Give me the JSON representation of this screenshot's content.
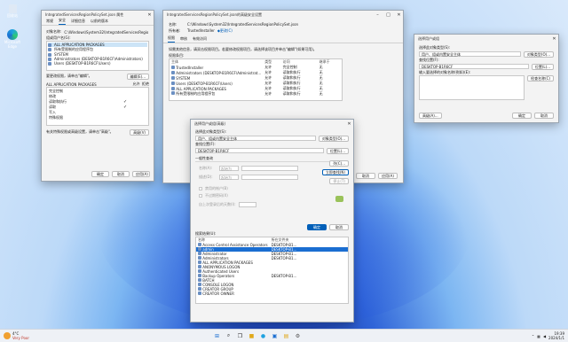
{
  "desktop": {
    "icon1": "回收站",
    "icon2": "Microsoft Edge"
  },
  "w1": {
    "title": "IntegratedServicesRegionPolicySet.json 属性",
    "tabs": [
      "常规",
      "安全",
      "详细信息",
      "以前的版本"
    ],
    "objname_label": "对象名称:",
    "objname": "C:\\Windows\\System32\\IntegratedServicesRegio",
    "group_label": "组或用户名(G):",
    "users": [
      "ALL APPLICATION PACKAGES",
      "所有受限制的应用程序包",
      "SYSTEM",
      "Administrators (DESKTOP-B1R6CF\\Administrators)",
      "Users (DESKTOP-B1R6CF\\Users)"
    ],
    "edit_hint": "要更改权限，请单击\"编辑\"。",
    "edit_btn": "编辑(E)...",
    "perm_for": "ALL APPLICATION PACKAGES",
    "allow": "允许",
    "deny": "拒绝",
    "perms": [
      {
        "n": "完全控制",
        "a": ""
      },
      {
        "n": "修改",
        "a": ""
      },
      {
        "n": "读取和执行",
        "a": "✓"
      },
      {
        "n": "读取",
        "a": "✓"
      },
      {
        "n": "写入",
        "a": ""
      },
      {
        "n": "特殊权限",
        "a": ""
      }
    ],
    "adv_hint": "有关特殊权限或高级设置，请单击\"高级\"。",
    "adv_btn": "高级(V)",
    "ok": "确定",
    "cancel": "取消",
    "apply": "应用(A)"
  },
  "w2": {
    "title": "IntegratedServicesRegionPolicySet.json的高级安全设置",
    "name_label": "名称:",
    "name": "C:\\Windows\\System32\\IntegratedServicesRegionPolicySet.json",
    "owner_label": "所有者:",
    "owner": "TrustedInstaller",
    "change": "更改(C)",
    "tabs": [
      "权限",
      "审核",
      "有效访问"
    ],
    "info": "如需其他信息，请双击权限项目。若要修改权限项目，请选择该项目并单击\"编辑\"(如果可用)。",
    "entries_label": "权限条目:",
    "cols": [
      "主体",
      "类型",
      "访问",
      "继承于"
    ],
    "rows": [
      [
        "TrustedInstaller",
        "允许",
        "完全控制",
        "无"
      ],
      [
        "Administrators (DESKTOP-B1R6CF\\Administrat...",
        "允许",
        "读取和执行",
        "无"
      ],
      [
        "SYSTEM",
        "允许",
        "读取和执行",
        "无"
      ],
      [
        "Users (DESKTOP-B1R6CF\\Users)",
        "允许",
        "读取和执行",
        "无"
      ],
      [
        "ALL APPLICATION PACKAGES",
        "允许",
        "读取和执行",
        "无"
      ],
      [
        "所有受限制的应用程序包",
        "允许",
        "读取和执行",
        "无"
      ]
    ],
    "ok": "确定",
    "cancel": "取消",
    "apply": "应用(A)"
  },
  "w3": {
    "title": "选择用户或组",
    "type_label": "选择此对象类型(S):",
    "type": "用户、组或内置安全主体",
    "type_btn": "对象类型(O)...",
    "loc_label": "查找位置(F):",
    "loc": "DESKTOP-B1R6CF",
    "loc_btn": "位置(L)...",
    "input_label": "输入要选择的对象名称(例如)(E):",
    "check_btn": "检查名称(C)",
    "adv_btn": "高级(A)...",
    "ok": "确定",
    "cancel": "取消"
  },
  "w4": {
    "title": "选择用户或组(高级)",
    "type_label": "选择此对象类型(S):",
    "type": "用户、组或内置安全主体",
    "type_btn": "对象类型(O)...",
    "loc_label": "查找位置(F):",
    "loc": "DESKTOP-B1R6CF",
    "loc_btn": "位置(L)...",
    "query_label": "一般性查询",
    "name_label": "名称(A):",
    "desc_label": "描述(D):",
    "starts": "起始为",
    "disabled": "禁用的帐户(B)",
    "noexpire": "不过期密码(X)",
    "days_label": "自上次登录后的天数(I):",
    "cols_btn": "列(C)...",
    "find_btn": "立即查找(N)",
    "stop_btn": "停止(T)",
    "results_label": "搜索结果(U):",
    "ok": "确定",
    "cancel": "取消",
    "res_cols": [
      "名称",
      "所在文件夹"
    ],
    "results": [
      [
        "Access Control Assistance Operators",
        "DESKTOP-B1..."
      ],
      [
        "admin",
        "DESKTOP-B1..."
      ],
      [
        "Administrator",
        "DESKTOP-B1..."
      ],
      [
        "Administrators",
        "DESKTOP-B1..."
      ],
      [
        "ALL APPLICATION PACKAGES",
        ""
      ],
      [
        "ANONYMOUS LOGON",
        ""
      ],
      [
        "Authenticated Users",
        ""
      ],
      [
        "Backup Operators",
        "DESKTOP-B1..."
      ],
      [
        "BATCH",
        ""
      ],
      [
        "CONSOLE LOGON",
        ""
      ],
      [
        "CREATOR GROUP",
        ""
      ],
      [
        "CREATOR OWNER",
        ""
      ]
    ]
  },
  "taskbar": {
    "weather_temp": "4°C",
    "weather_desc": "Very Poor",
    "time": "19:39",
    "date": "2024/1/1"
  },
  "colors": {
    "accent": "#005fb8",
    "selection": "#1b6ed1"
  }
}
